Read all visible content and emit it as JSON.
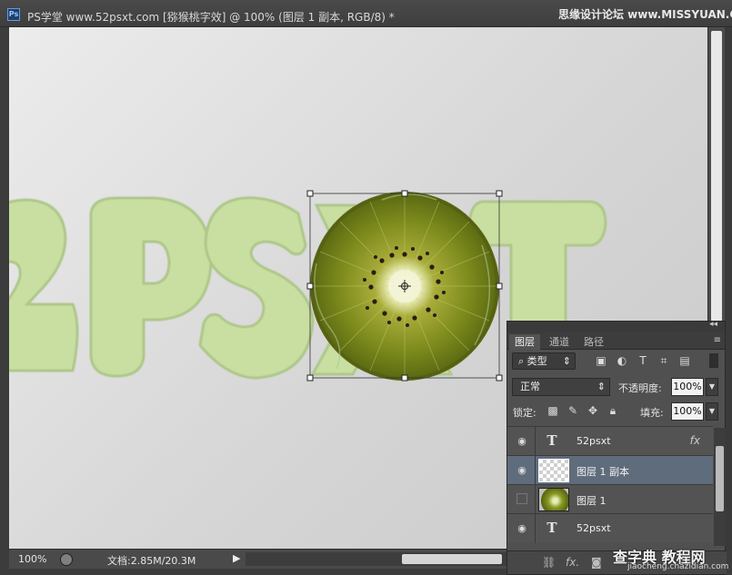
{
  "window": {
    "app_icon": "Ps",
    "title": "PS学堂 www.52psxt.com [猕猴桃字效] @ 100% (图层 1 副本, RGB/8) *",
    "watermark": "思缘设计论坛 www.MISSYUAN.COM",
    "controls": [
      "minimize-icon",
      "maximize-icon",
      "close-icon"
    ]
  },
  "canvas": {
    "artwork_text": "2PSXT",
    "background_colors": [
      "#ececec",
      "#c9c9c9"
    ],
    "letter_color": "#c9dfa2",
    "kiwi_colors": [
      "#7f8a1f",
      "#e9eec0",
      "#3a2516"
    ]
  },
  "status": {
    "zoom": "100%",
    "doc_info": "文档:2.85M/20.3M"
  },
  "layers_panel": {
    "tabs": [
      "图层",
      "通道",
      "路径"
    ],
    "active_tab": 0,
    "filter_kind": "类型",
    "blend_mode": "正常",
    "opacity_label": "不透明度:",
    "opacity_value": "100%",
    "lock_label": "锁定:",
    "fill_label": "填充:",
    "fill_value": "100%",
    "layers": [
      {
        "name": "52psxt",
        "type": "text",
        "visible": true,
        "fx": "fx",
        "selected": false
      },
      {
        "name": "图层 1 副本",
        "type": "image-transparent",
        "visible": true,
        "selected": true
      },
      {
        "name": "图层 1",
        "type": "image-kiwi",
        "visible": false,
        "selected": false
      },
      {
        "name": "52psxt",
        "type": "text",
        "visible": true,
        "selected": false
      }
    ],
    "bottom_icons": [
      "link-icon",
      "fx-icon",
      "mask-icon",
      "adjustment-icon",
      "group-icon",
      "new-layer-icon",
      "trash-icon"
    ]
  },
  "site_watermark": {
    "line1": "查字典 教程网",
    "line2": "jiaocheng.chazidian.com"
  }
}
